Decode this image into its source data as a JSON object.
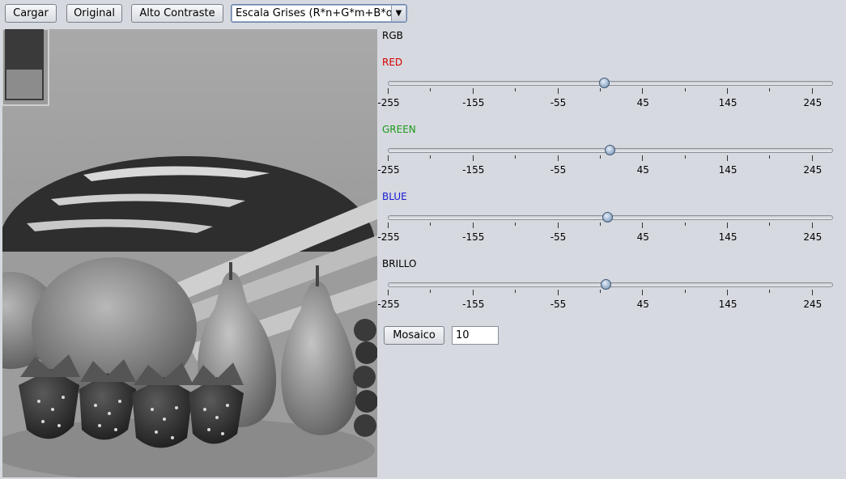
{
  "toolbar": {
    "load": "Cargar",
    "original": "Original",
    "contrast": "Alto Contraste",
    "mode_selected": "Escala Grises (R*n+G*m+B*o)"
  },
  "panel": {
    "header": "RGB",
    "sliders": [
      {
        "label": "RED",
        "color": "#d40000",
        "value": 0
      },
      {
        "label": "GREEN",
        "color": "#1a9a1a",
        "value": 7
      },
      {
        "label": "BLUE",
        "color": "#1a1ad4",
        "value": 4
      },
      {
        "label": "BRILLO",
        "color": "#000000",
        "value": 2
      }
    ],
    "scale": {
      "min": -255,
      "max": 270,
      "major_ticks": [
        -255,
        -155,
        -55,
        45,
        145,
        245
      ],
      "minor_step": 50
    },
    "mosaic_button": "Mosaico",
    "mosaic_value": "10"
  }
}
